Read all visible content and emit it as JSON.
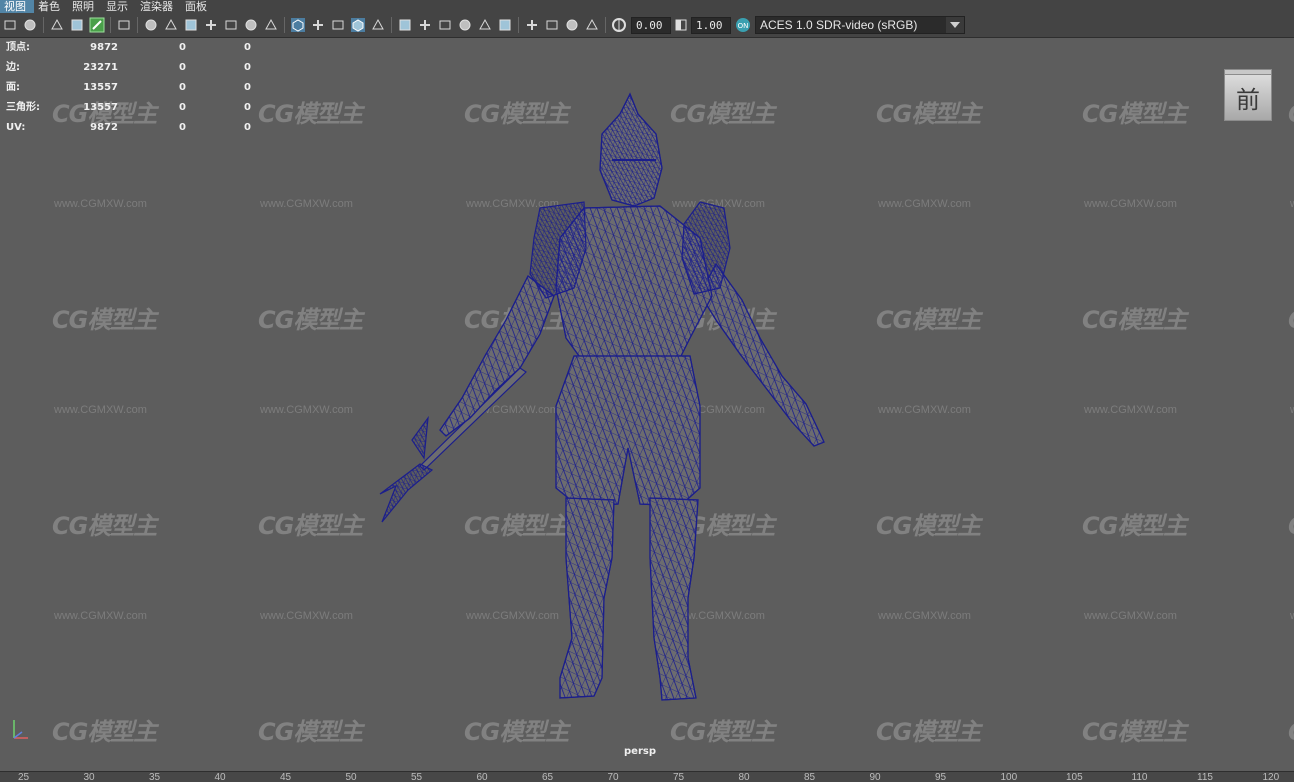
{
  "menu": {
    "items": [
      {
        "label": "视图",
        "active": true
      },
      {
        "label": "着色",
        "active": false
      },
      {
        "label": "照明",
        "active": false
      },
      {
        "label": "显示",
        "active": false
      },
      {
        "label": "渲染器",
        "active": false
      },
      {
        "label": "面板",
        "active": false
      }
    ]
  },
  "toolbar": {
    "exposure_value": "0.00",
    "gamma_value": "1.00",
    "colorspace_label": "ACES 1.0 SDR-video (sRGB)",
    "icons": [
      "camera-select-icon",
      "camera-attributes-icon",
      "bookmark-icon",
      "image-plane-icon",
      "grease-pencil-icon",
      "2d-pan-zoom-icon",
      "grid-icon",
      "film-gate-icon",
      "resolution-gate-icon",
      "gate-mask-icon",
      "field-chart-icon",
      "safe-action-icon",
      "safe-title-icon",
      "wireframe-icon",
      "smooth-shade-icon",
      "default-material-icon",
      "wireframe-on-shaded-icon",
      "textured-icon",
      "lights-icon",
      "shadows-icon",
      "screen-space-ao-icon",
      "motion-blur-icon",
      "anti-aliasing-icon",
      "depth-of-field-icon",
      "isolate-select-icon",
      "xray-icon",
      "xray-joints-icon",
      "backface-culling-icon",
      "exposure-icon",
      "gamma-icon",
      "color-management-icon"
    ]
  },
  "stats": {
    "rows": [
      {
        "label": "顶点:",
        "v1": "9872",
        "v2": "0",
        "v3": "0"
      },
      {
        "label": "边:",
        "v1": "23271",
        "v2": "0",
        "v3": "0"
      },
      {
        "label": "面:",
        "v1": "13557",
        "v2": "0",
        "v3": "0"
      },
      {
        "label": "三角形:",
        "v1": "13557",
        "v2": "0",
        "v3": "0"
      },
      {
        "label": "UV:",
        "v1": "9872",
        "v2": "0",
        "v3": "0"
      }
    ]
  },
  "viewcube": {
    "face_label": "前"
  },
  "camera": {
    "name": "persp"
  },
  "watermark": {
    "logo": "CG模型主",
    "url": "www.CGMXW.com"
  },
  "ruler": {
    "ticks": [
      "25",
      "30",
      "35",
      "40",
      "45",
      "50",
      "55",
      "60",
      "65",
      "70",
      "75",
      "80",
      "85",
      "90",
      "95",
      "100",
      "105",
      "110",
      "115",
      "120"
    ]
  },
  "colors": {
    "wireframe": "#1b1e8c",
    "background": "#5d5d5d",
    "menu_active": "#5285a6"
  }
}
